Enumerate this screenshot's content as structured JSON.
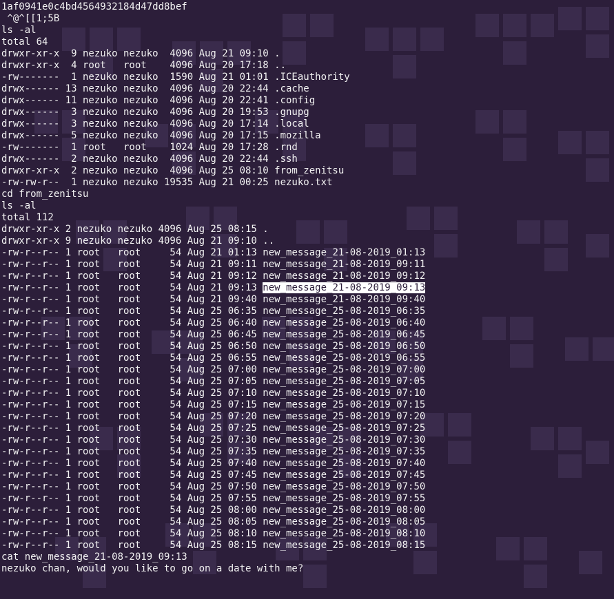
{
  "header_lines": [
    "1af0941e0c4bd4564932184d47dd8bef",
    " ^@^[[1;5B",
    "ls -al",
    "total 64"
  ],
  "home_listing": [
    "drwxr-xr-x  9 nezuko nezuko  4096 Aug 21 09:10 .",
    "drwxr-xr-x  4 root   root    4096 Aug 20 17:18 ..",
    "-rw-------  1 nezuko nezuko  1590 Aug 21 01:01 .ICEauthority",
    "drwx------ 13 nezuko nezuko  4096 Aug 20 22:44 .cache",
    "drwx------ 11 nezuko nezuko  4096 Aug 20 22:41 .config",
    "drwx------  3 nezuko nezuko  4096 Aug 20 19:53 .gnupg",
    "drwx------  3 nezuko nezuko  4096 Aug 20 17:14 .local",
    "drwx------  5 nezuko nezuko  4096 Aug 20 17:15 .mozilla",
    "-rw-------  1 root   root    1024 Aug 20 17:28 .rnd",
    "drwx------  2 nezuko nezuko  4096 Aug 20 22:44 .ssh",
    "drwxr-xr-x  2 nezuko nezuko  4096 Aug 25 08:10 from_zenitsu",
    "-rw-rw-r--  1 nezuko nezuko 19535 Aug 21 00:25 nezuko.txt"
  ],
  "cd_line": "cd from_zenitsu",
  "ls2_line": "ls -al",
  "total2_line": "total 112",
  "zenitsu_head": [
    "drwxr-xr-x 2 nezuko nezuko 4096 Aug 25 08:15 .",
    "drwxr-xr-x 9 nezuko nezuko 4096 Aug 21 09:10 .."
  ],
  "zenitsu_files": [
    {
      "prefix": "-rw-r--r-- 1 root   root     54 Aug 21 01:13 ",
      "name": "new_message_21-08-2019_01:13",
      "hl": false
    },
    {
      "prefix": "-rw-r--r-- 1 root   root     54 Aug 21 09:11 ",
      "name": "new_message_21-08-2019_09:11",
      "hl": false
    },
    {
      "prefix": "-rw-r--r-- 1 root   root     54 Aug 21 09:12 ",
      "name": "new_message_21-08-2019_09:12",
      "hl": false
    },
    {
      "prefix": "-rw-r--r-- 1 root   root     54 Aug 21 09:13 ",
      "name": "new_message_21-08-2019_09:13",
      "hl": true
    },
    {
      "prefix": "-rw-r--r-- 1 root   root     54 Aug 21 09:40 ",
      "name": "new_message_21-08-2019_09:40",
      "hl": false
    },
    {
      "prefix": "-rw-r--r-- 1 root   root     54 Aug 25 06:35 ",
      "name": "new_message_25-08-2019_06:35",
      "hl": false
    },
    {
      "prefix": "-rw-r--r-- 1 root   root     54 Aug 25 06:40 ",
      "name": "new_message_25-08-2019_06:40",
      "hl": false
    },
    {
      "prefix": "-rw-r--r-- 1 root   root     54 Aug 25 06:45 ",
      "name": "new_message_25-08-2019_06:45",
      "hl": false
    },
    {
      "prefix": "-rw-r--r-- 1 root   root     54 Aug 25 06:50 ",
      "name": "new_message_25-08-2019_06:50",
      "hl": false
    },
    {
      "prefix": "-rw-r--r-- 1 root   root     54 Aug 25 06:55 ",
      "name": "new_message_25-08-2019_06:55",
      "hl": false
    },
    {
      "prefix": "-rw-r--r-- 1 root   root     54 Aug 25 07:00 ",
      "name": "new_message_25-08-2019_07:00",
      "hl": false
    },
    {
      "prefix": "-rw-r--r-- 1 root   root     54 Aug 25 07:05 ",
      "name": "new_message_25-08-2019_07:05",
      "hl": false
    },
    {
      "prefix": "-rw-r--r-- 1 root   root     54 Aug 25 07:10 ",
      "name": "new_message_25-08-2019_07:10",
      "hl": false
    },
    {
      "prefix": "-rw-r--r-- 1 root   root     54 Aug 25 07:15 ",
      "name": "new_message_25-08-2019_07:15",
      "hl": false
    },
    {
      "prefix": "-rw-r--r-- 1 root   root     54 Aug 25 07:20 ",
      "name": "new_message_25-08-2019_07:20",
      "hl": false
    },
    {
      "prefix": "-rw-r--r-- 1 root   root     54 Aug 25 07:25 ",
      "name": "new_message_25-08-2019_07:25",
      "hl": false
    },
    {
      "prefix": "-rw-r--r-- 1 root   root     54 Aug 25 07:30 ",
      "name": "new_message_25-08-2019_07:30",
      "hl": false
    },
    {
      "prefix": "-rw-r--r-- 1 root   root     54 Aug 25 07:35 ",
      "name": "new_message_25-08-2019_07:35",
      "hl": false
    },
    {
      "prefix": "-rw-r--r-- 1 root   root     54 Aug 25 07:40 ",
      "name": "new_message_25-08-2019_07:40",
      "hl": false
    },
    {
      "prefix": "-rw-r--r-- 1 root   root     54 Aug 25 07:45 ",
      "name": "new_message_25-08-2019_07:45",
      "hl": false
    },
    {
      "prefix": "-rw-r--r-- 1 root   root     54 Aug 25 07:50 ",
      "name": "new_message_25-08-2019_07:50",
      "hl": false
    },
    {
      "prefix": "-rw-r--r-- 1 root   root     54 Aug 25 07:55 ",
      "name": "new_message_25-08-2019_07:55",
      "hl": false
    },
    {
      "prefix": "-rw-r--r-- 1 root   root     54 Aug 25 08:00 ",
      "name": "new_message_25-08-2019_08:00",
      "hl": false
    },
    {
      "prefix": "-rw-r--r-- 1 root   root     54 Aug 25 08:05 ",
      "name": "new_message_25-08-2019_08:05",
      "hl": false
    },
    {
      "prefix": "-rw-r--r-- 1 root   root     54 Aug 25 08:10 ",
      "name": "new_message_25-08-2019_08:10",
      "hl": false
    },
    {
      "prefix": "-rw-r--r-- 1 root   root     54 Aug 25 08:15 ",
      "name": "new_message_25-08-2019_08:15",
      "hl": false
    }
  ],
  "cat_line": "cat new_message_21-08-2019_09:13",
  "cat_output": "nezuko chan, would you like to go on a date with me?"
}
